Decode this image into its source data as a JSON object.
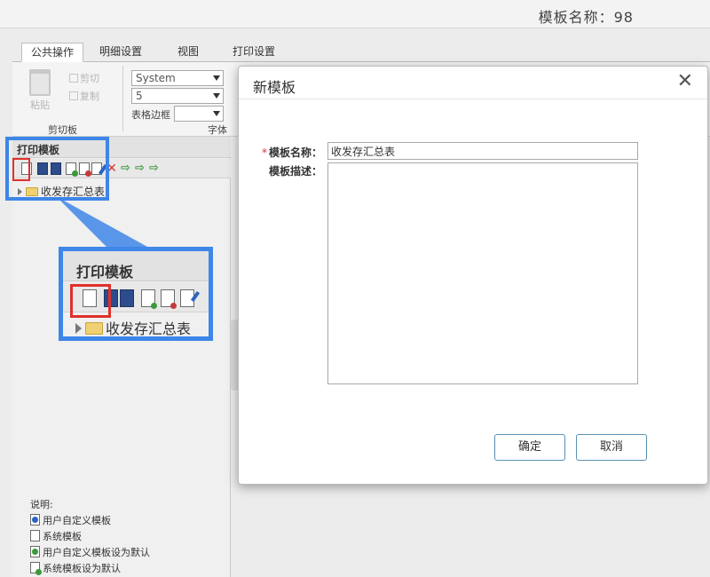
{
  "title": "模板名称：98",
  "ribbon": {
    "tabs": [
      "公共操作",
      "明细设置",
      "视图",
      "打印设置"
    ],
    "clipboard": {
      "paste": "粘贴",
      "cut": "剪切",
      "copy": "复制",
      "group_label": "剪切板"
    },
    "font": {
      "family": "System",
      "size": "5",
      "border_label": "表格边框",
      "group_label": "字体"
    }
  },
  "left_panel": {
    "title": "打印模板",
    "tree_item": "收发存汇总表"
  },
  "zoom": {
    "title": "打印模板",
    "tree_item": "收发存汇总表"
  },
  "legend": {
    "title": "说明:",
    "items": [
      "用户自定义模板",
      "系统模板",
      "用户自定义模板设为默认",
      "系统模板设为默认"
    ]
  },
  "dialog": {
    "title": "新模板",
    "close": "✕",
    "name_label": "模板名称：",
    "required_mark": "*",
    "name_value": "收发存汇总表",
    "desc_label": "模板描述：",
    "desc_value": "",
    "ok": "确定",
    "cancel": "取消"
  }
}
